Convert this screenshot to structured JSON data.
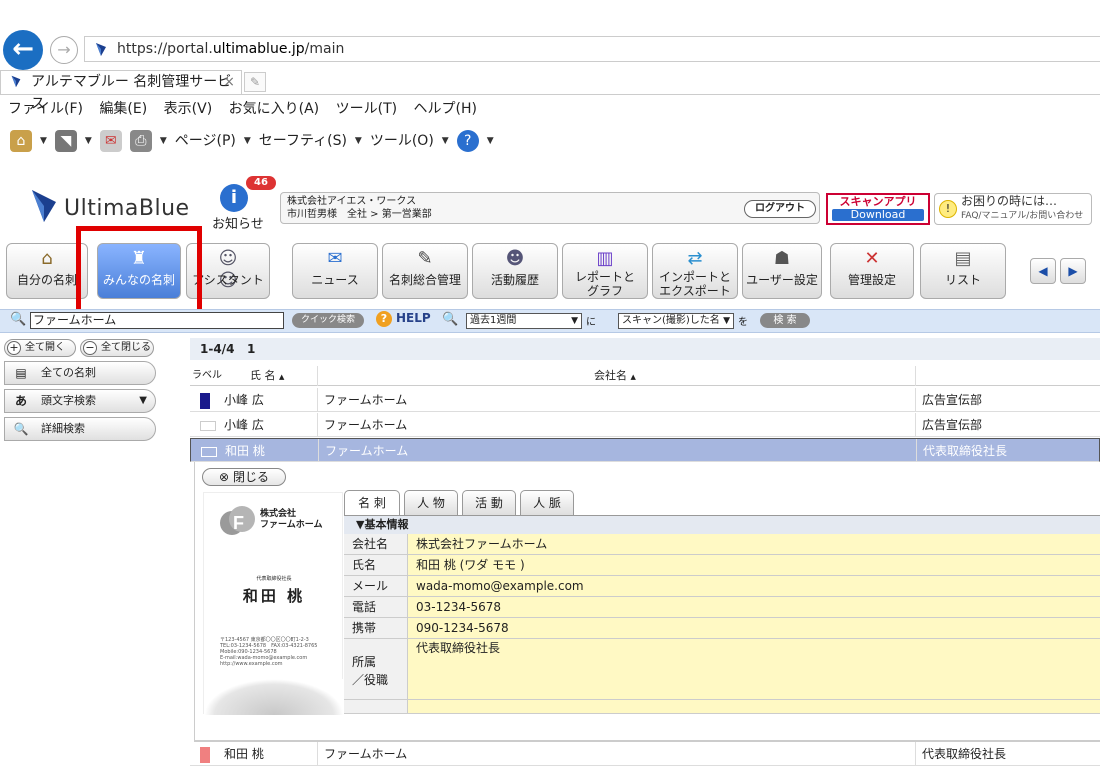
{
  "browser": {
    "url_prefix": "https://portal.",
    "url_domain": "ultimablue.jp",
    "url_path": "/main",
    "tab_title": "アルテマブルー 名刺管理サービス",
    "tab_close": "×",
    "menu": [
      "ファイル(F)",
      "編集(E)",
      "表示(V)",
      "お気に入り(A)",
      "ツール(T)",
      "ヘルプ(H)"
    ],
    "cmd_page": "ページ(P)",
    "cmd_safety": "セーフティ(S)",
    "cmd_tools": "ツール(O)"
  },
  "header": {
    "logo_text": "UltimaBlue",
    "notice_badge": "46",
    "notice_label": "お知らせ",
    "company": "株式会社アイエス・ワークス",
    "user_line": "市川哲男様　全社 > 第一営業部",
    "logout": "ログアウト",
    "scan_app": "スキャンアプリ",
    "download": "Download",
    "help_title": "お困りの時には…",
    "help_sub": "FAQ/マニュアル/お問い合わせ",
    "accent": "#2a6fcf"
  },
  "nav": [
    {
      "label": "自分の名刺",
      "icon": "house-icon"
    },
    {
      "label": "みんなの名刺",
      "icon": "stamp-icon",
      "active": true
    },
    {
      "label": "アシスタント",
      "icon": "people-icon"
    },
    {
      "label": "ニュース",
      "icon": "news-icon"
    },
    {
      "label": "名刺総合管理",
      "icon": "card-tools-icon"
    },
    {
      "label": "活動履歴",
      "icon": "person-card-icon"
    },
    {
      "label_1": "レポートと",
      "label_2": "グラフ",
      "icon": "report-icon"
    },
    {
      "label_1": "インポートと",
      "label_2": "エクスポート",
      "icon": "import-export-icon"
    },
    {
      "label": "ユーザー設定",
      "icon": "user-settings-icon"
    },
    {
      "label": "管理設定",
      "icon": "admin-tools-icon"
    },
    {
      "label": "リスト",
      "icon": "list-icon"
    }
  ],
  "search": {
    "value": "ファームホーム",
    "quick": "クイック検索",
    "help": "HELP",
    "period": "過去1週間",
    "ni": "に",
    "action": "スキャン(撮影)した名",
    "wo": "を",
    "button": "検 索"
  },
  "sidebar": {
    "expand_all": "全て開く",
    "collapse_all": "全て閉じる",
    "all_cards": "全ての名刺",
    "initial_search": "頭文字検索",
    "detail_search": "詳細検索"
  },
  "list": {
    "count": "1-4/4",
    "page": "1",
    "col_label": "ラベル",
    "col_name": "氏 名",
    "col_company": "会社名",
    "rows": [
      {
        "name": "小峰 広",
        "company": "ファームホーム",
        "title": "広告宣伝部",
        "label_color": "#1a1a8c"
      },
      {
        "name": "小峰 広",
        "company": "ファームホーム",
        "title": "広告宣伝部",
        "label_color": "#ffffff"
      },
      {
        "name": "和田 桃",
        "company": "ファームホーム",
        "title": "代表取締役社長",
        "label_color": "#ffffff"
      },
      {
        "name": "和田 桃",
        "company": "ファームホーム",
        "title": "代表取締役社長",
        "label_color": "#f08080"
      }
    ]
  },
  "detail": {
    "close": "閉じる",
    "tabs": [
      "名 刺",
      "人 物",
      "活 動",
      "人 脈"
    ],
    "section": "▼基本情報",
    "fields": [
      {
        "label": "会社名",
        "value": "株式会社ファームホーム"
      },
      {
        "label": "氏名",
        "value": "和田 桃 (ワダ モモ )"
      },
      {
        "label": "メール",
        "value": "wada-momo@example.com"
      },
      {
        "label": "電話",
        "value": "03-1234-5678"
      },
      {
        "label": "携帯",
        "value": "090-1234-5678"
      },
      {
        "label": "所属\n／役職",
        "value": "代表取締役社長"
      }
    ],
    "card": {
      "company_1": "株式会社",
      "company_2": "ファームホーム",
      "role": "代表取締役社長",
      "name": "和田 桃",
      "addr_1": "〒123-4567 東京都〇〇区〇〇町1-2-3",
      "addr_2": "TEL:03-1234-5678　FAX:03-4321-8765",
      "addr_3": "Mobile:090-1234-5678",
      "addr_4": "E-mail:wada-momo@example.com",
      "addr_5": "http://www.example.com"
    }
  }
}
